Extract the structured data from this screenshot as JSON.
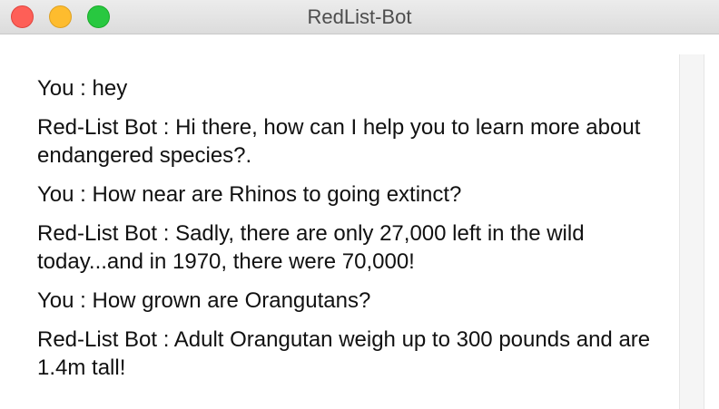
{
  "window": {
    "title": "RedList-Bot"
  },
  "chat": {
    "messages": [
      {
        "text": "You : hey"
      },
      {
        "text": "Red-List Bot : Hi there, how can I help you to learn more about endangered species?."
      },
      {
        "text": "You : How near are Rhinos to going extinct?"
      },
      {
        "text": "Red-List Bot : Sadly, there are only 27,000 left in the wild today...and in 1970, there were 70,000!"
      },
      {
        "text": "You : How grown are Orangutans?"
      },
      {
        "text": "Red-List Bot : Adult Orangutan weigh up to 300 pounds and are 1.4m tall!"
      }
    ]
  },
  "colors": {
    "close": "#fe5f57",
    "minimize": "#febc2e",
    "zoom": "#28c840"
  }
}
